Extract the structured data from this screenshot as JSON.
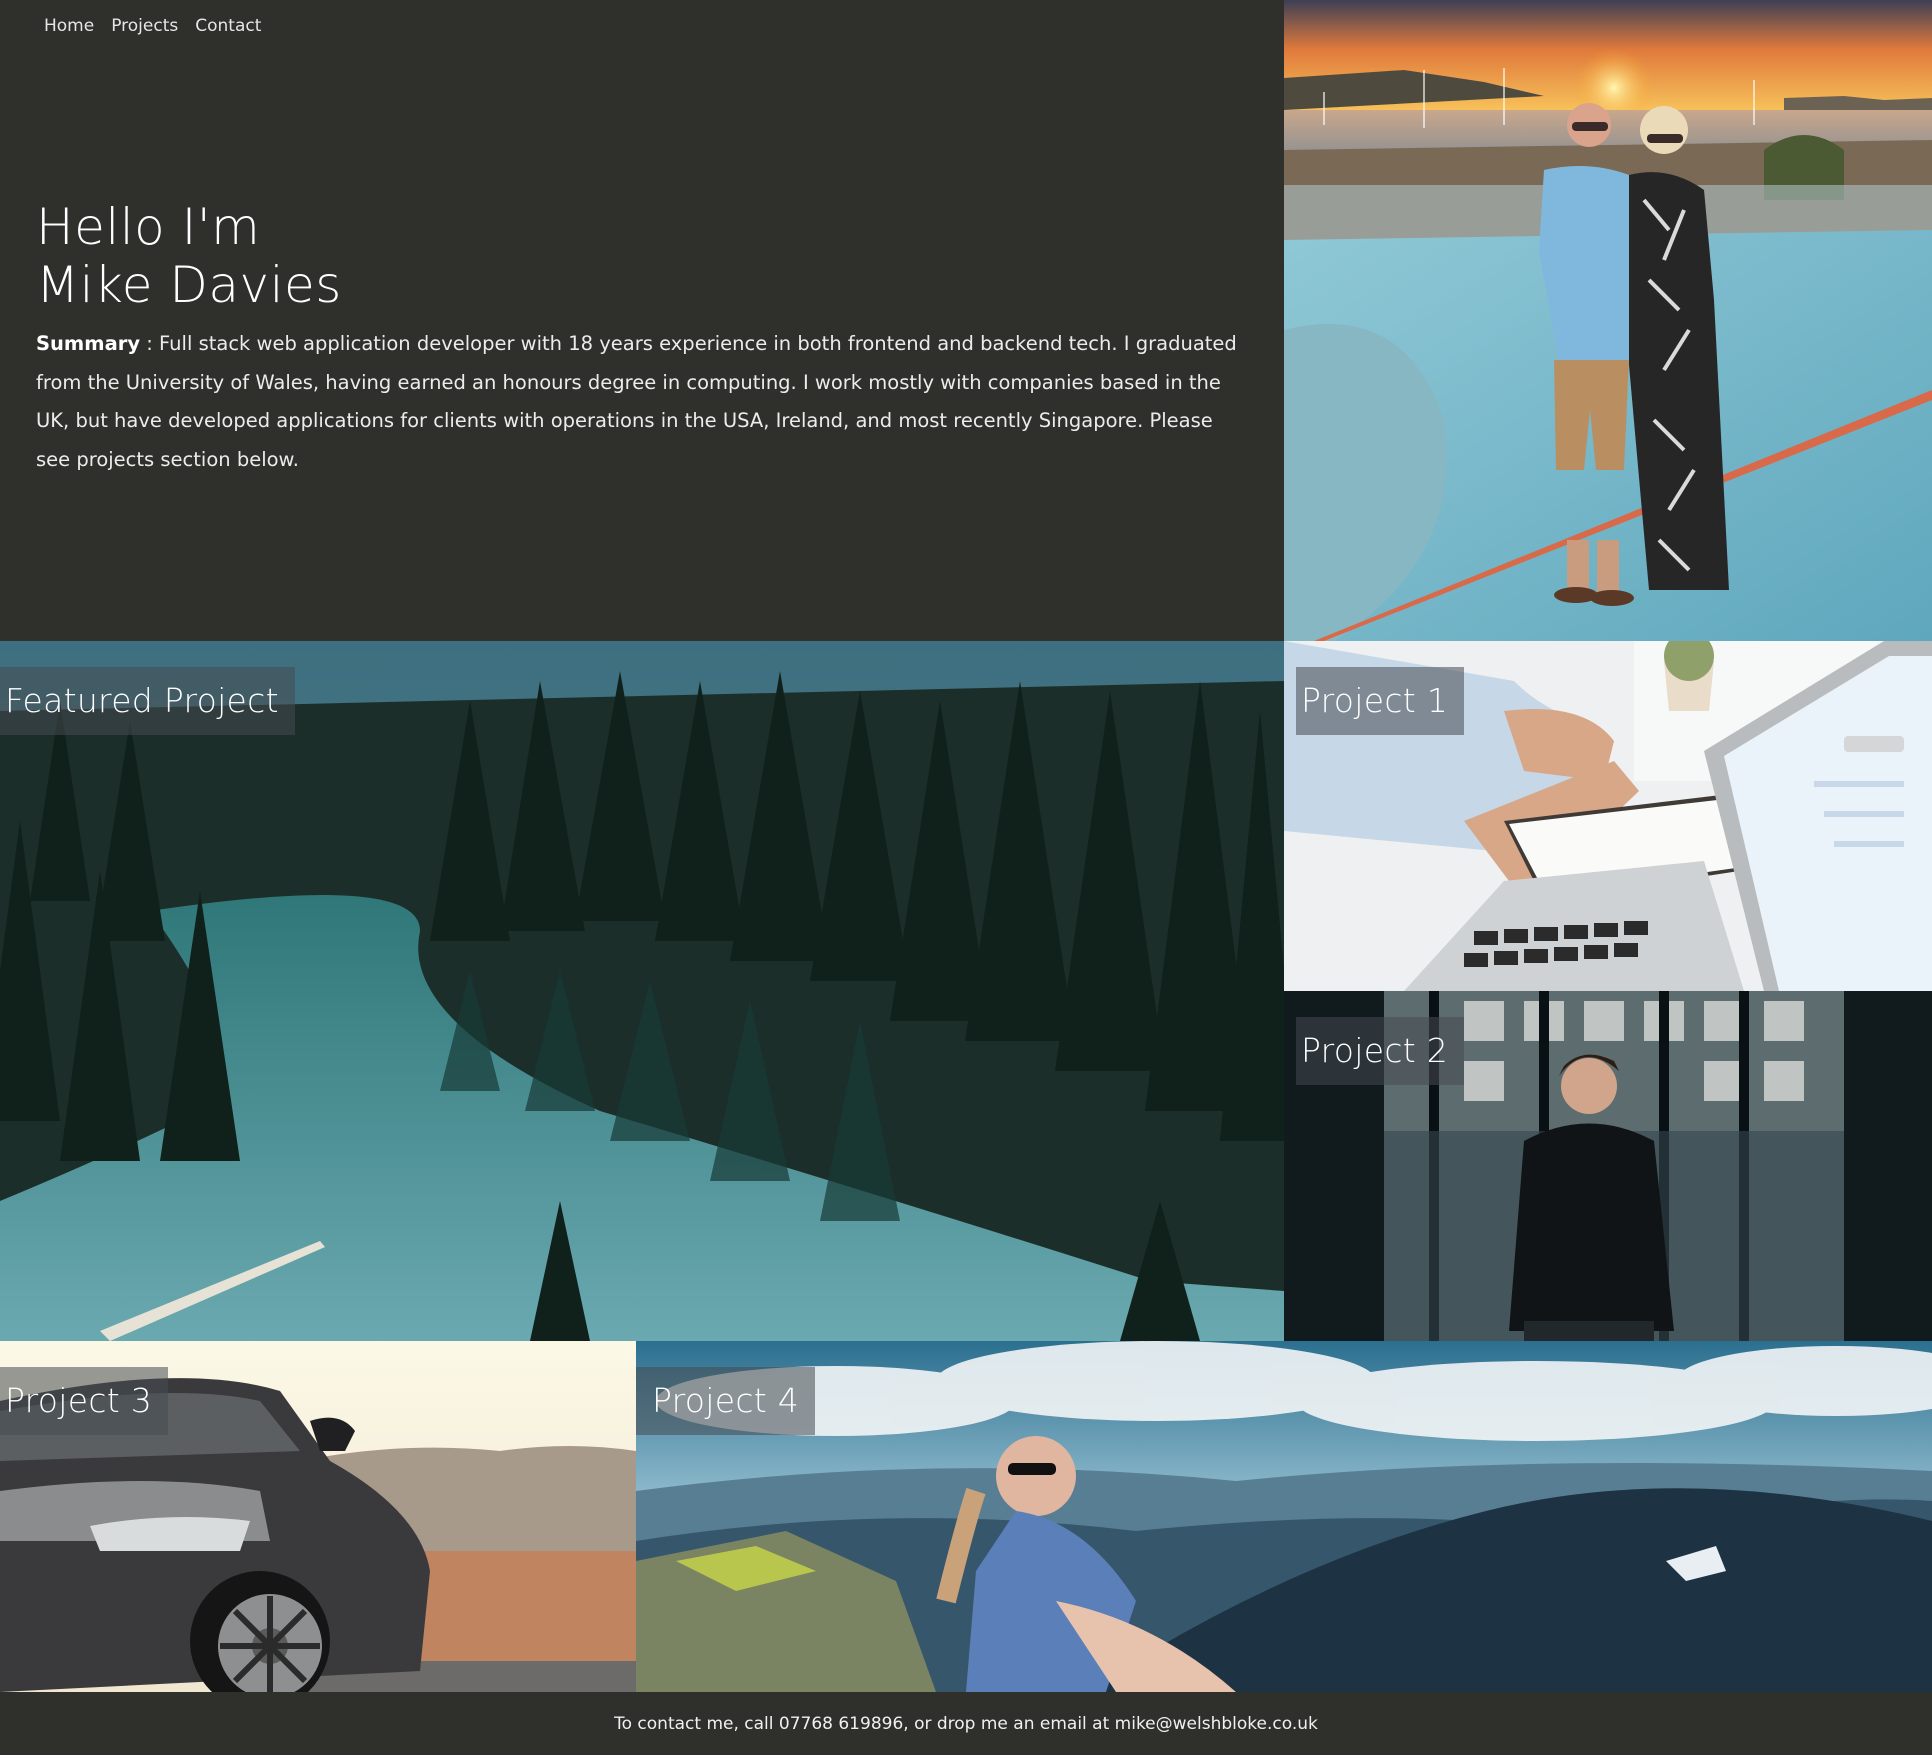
{
  "nav": {
    "items": [
      "Home",
      "Projects",
      "Contact"
    ]
  },
  "hero": {
    "greeting": "Hello I'm",
    "name": "Mike Davies",
    "summary_label": "Summary",
    "summary_text": " : Full stack web application developer with 18 years experience in both frontend and backend tech. I graduated from the University of Wales, having earned an honours degree in computing. I work mostly with companies based in the UK, but have developed applications for clients with operations in the USA, Ireland, and most recently Singapore. Please see projects section below."
  },
  "projects": {
    "featured": "Featured Project",
    "p1": "Project 1",
    "p2": "Project 2",
    "p3": "Project 3",
    "p4": "Project 4"
  },
  "footer": {
    "contact": "To contact me, call 07768 619896, or drop me an email at mike@welshbloke.co.uk"
  }
}
